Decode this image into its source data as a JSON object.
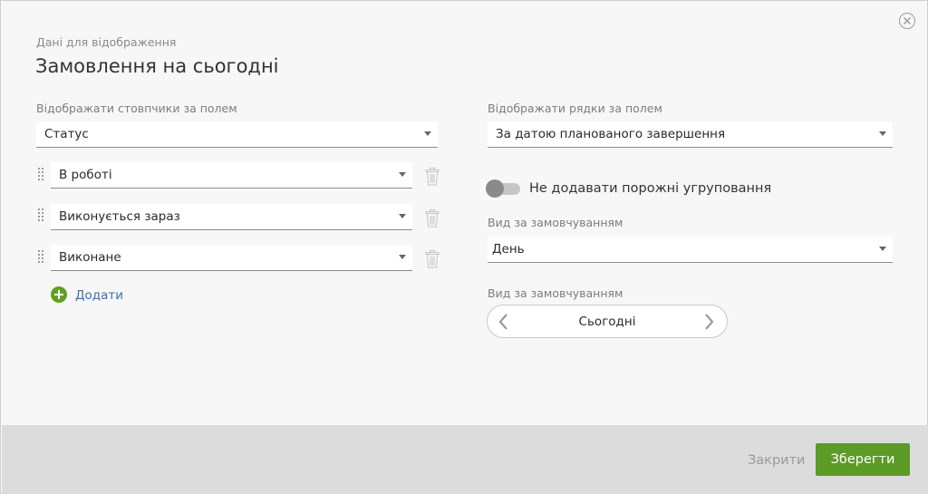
{
  "dialog": {
    "subtitle": "Дані для відображення",
    "title": "Замовлення на сьогодні"
  },
  "columns": {
    "label": "Відображати стовпчики за полем",
    "field_value": "Статус",
    "items": [
      {
        "value": "В роботі"
      },
      {
        "value": "Виконується зараз"
      },
      {
        "value": "Виконане"
      }
    ],
    "add_label": "Додати"
  },
  "rows": {
    "label": "Відображати рядки за полем",
    "field_value": "За датою планованого завершення",
    "empty_groups_toggle": {
      "label": "Не додавати порожні угруповання",
      "on": false
    },
    "default_view": {
      "label": "Вид за замовчуванням",
      "value": "День"
    },
    "default_period": {
      "label": "Вид за замовчуванням",
      "value": "Сьогодні"
    }
  },
  "footer": {
    "close_label": "Закрити",
    "save_label": "Зберегти"
  },
  "colors": {
    "accent_green": "#5c9b25",
    "link_blue": "#3d6fa8",
    "footer_bg": "#dcdcdc"
  },
  "icons": [
    "close-icon",
    "drag-handle-icon",
    "trash-icon",
    "plus-circle-icon",
    "chevron-left-icon",
    "chevron-right-icon",
    "dropdown-arrow-icon"
  ]
}
